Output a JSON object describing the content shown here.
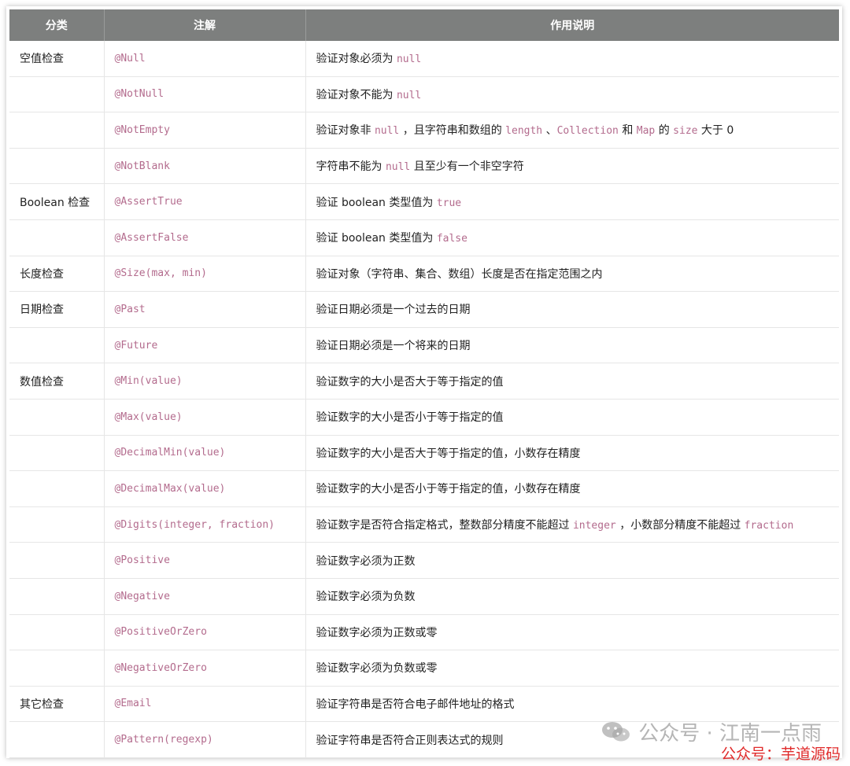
{
  "table": {
    "headers": [
      "分类",
      "注解",
      "作用说明"
    ],
    "rows": [
      {
        "category": "空值检查",
        "annotation": "@Null",
        "desc": [
          {
            "t": "验证对象必须为 "
          },
          {
            "c": "null"
          }
        ]
      },
      {
        "category": "",
        "annotation": "@NotNull",
        "desc": [
          {
            "t": "验证对象不能为 "
          },
          {
            "c": "null"
          }
        ]
      },
      {
        "category": "",
        "annotation": "@NotEmpty",
        "desc": [
          {
            "t": "验证对象非 "
          },
          {
            "c": "null"
          },
          {
            "t": " ，且字符串和数组的 "
          },
          {
            "c": "length"
          },
          {
            "t": " 、"
          },
          {
            "c": "Collection"
          },
          {
            "t": " 和 "
          },
          {
            "c": "Map"
          },
          {
            "t": " 的 "
          },
          {
            "c": "size"
          },
          {
            "t": " 大于 0"
          }
        ]
      },
      {
        "category": "",
        "annotation": "@NotBlank",
        "desc": [
          {
            "t": "字符串不能为 "
          },
          {
            "c": "null"
          },
          {
            "t": " 且至少有一个非空字符"
          }
        ]
      },
      {
        "category": "Boolean 检查",
        "annotation": "@AssertTrue",
        "desc": [
          {
            "t": "验证 boolean 类型值为 "
          },
          {
            "c": "true"
          }
        ]
      },
      {
        "category": "",
        "annotation": "@AssertFalse",
        "desc": [
          {
            "t": "验证 boolean 类型值为 "
          },
          {
            "c": "false"
          }
        ]
      },
      {
        "category": "长度检查",
        "annotation": "@Size(max, min)",
        "desc": [
          {
            "t": "验证对象（字符串、集合、数组）长度是否在指定范围之内"
          }
        ]
      },
      {
        "category": "日期检查",
        "annotation": "@Past",
        "desc": [
          {
            "t": "验证日期必须是一个过去的日期"
          }
        ]
      },
      {
        "category": "",
        "annotation": "@Future",
        "desc": [
          {
            "t": "验证日期必须是一个将来的日期"
          }
        ]
      },
      {
        "category": "数值检查",
        "annotation": "@Min(value)",
        "desc": [
          {
            "t": "验证数字的大小是否大于等于指定的值"
          }
        ]
      },
      {
        "category": "",
        "annotation": "@Max(value)",
        "desc": [
          {
            "t": "验证数字的大小是否小于等于指定的值"
          }
        ]
      },
      {
        "category": "",
        "annotation": "@DecimalMin(value)",
        "desc": [
          {
            "t": "验证数字的大小是否大于等于指定的值，小数存在精度"
          }
        ]
      },
      {
        "category": "",
        "annotation": "@DecimalMax(value)",
        "desc": [
          {
            "t": "验证数字的大小是否小于等于指定的值，小数存在精度"
          }
        ]
      },
      {
        "category": "",
        "annotation": "@Digits(integer, fraction)",
        "desc": [
          {
            "t": "验证数字是否符合指定格式，整数部分精度不能超过 "
          },
          {
            "c": "integer"
          },
          {
            "t": " ，小数部分精度不能超过 "
          },
          {
            "c": "fraction"
          }
        ]
      },
      {
        "category": "",
        "annotation": "@Positive",
        "desc": [
          {
            "t": "验证数字必须为正数"
          }
        ]
      },
      {
        "category": "",
        "annotation": "@Negative",
        "desc": [
          {
            "t": "验证数字必须为负数"
          }
        ]
      },
      {
        "category": "",
        "annotation": "@PositiveOrZero",
        "desc": [
          {
            "t": "验证数字必须为正数或零"
          }
        ]
      },
      {
        "category": "",
        "annotation": "@NegativeOrZero",
        "desc": [
          {
            "t": "验证数字必须为负数或零"
          }
        ]
      },
      {
        "category": "其它检查",
        "annotation": "@Email",
        "desc": [
          {
            "t": "验证字符串是否符合电子邮件地址的格式"
          }
        ]
      },
      {
        "category": "",
        "annotation": "@Pattern(regexp)",
        "desc": [
          {
            "t": "验证字符串是否符合正则表达式的规则"
          }
        ]
      }
    ]
  },
  "watermark": {
    "gray": "公众号 · 江南一点雨",
    "red": "公众号：芋道源码"
  },
  "colors": {
    "header_bg": "#7d7f7e",
    "code": "#b36b8d",
    "watermark_red": "#e02b2b"
  },
  "icons": {
    "wechat": "wechat-icon"
  }
}
